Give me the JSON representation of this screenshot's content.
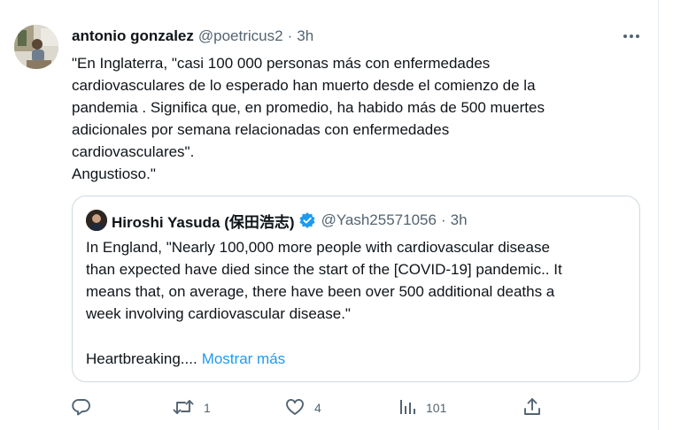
{
  "tweet": {
    "author_name": "antonio gonzalez",
    "handle": "@poetricus2",
    "separator": "·",
    "time": "3h",
    "text": "\"En Inglaterra, \"casi 100 000 personas más con enfermedades\ncardiovasculares de lo esperado han muerto desde el comienzo de la\npandemia . Significa que, en promedio, ha habido más de 500 muertes\nadicionales por semana relacionadas con enfermedades\ncardiovasculares\".\nAngustioso.\""
  },
  "quote": {
    "author_name": "Hiroshi Yasuda (保田浩志)",
    "handle": "@Yash25571056",
    "separator": "·",
    "time": "3h",
    "lines": [
      "In England, \"Nearly 100,000 more people with cardiovascular disease",
      "than expected have died since the start of the [COVID-19] pandemic.. It",
      "means that, on average, there have been over 500 additional deaths a",
      "week involving cardiovascular disease.\""
    ],
    "last_line": "Heartbreaking....",
    "show_more": "Mostrar más"
  },
  "actions": {
    "reply_count": "",
    "retweet_count": "1",
    "like_count": "4",
    "views_count": "101"
  },
  "colors": {
    "text": "#0f1419",
    "secondary": "#536471",
    "link": "#1d9bf0",
    "border": "#cfd9de",
    "verified": "#1d9bf0"
  },
  "icons": [
    "more-icon",
    "verified-icon",
    "reply-icon",
    "retweet-icon",
    "like-icon",
    "views-icon",
    "share-icon"
  ]
}
